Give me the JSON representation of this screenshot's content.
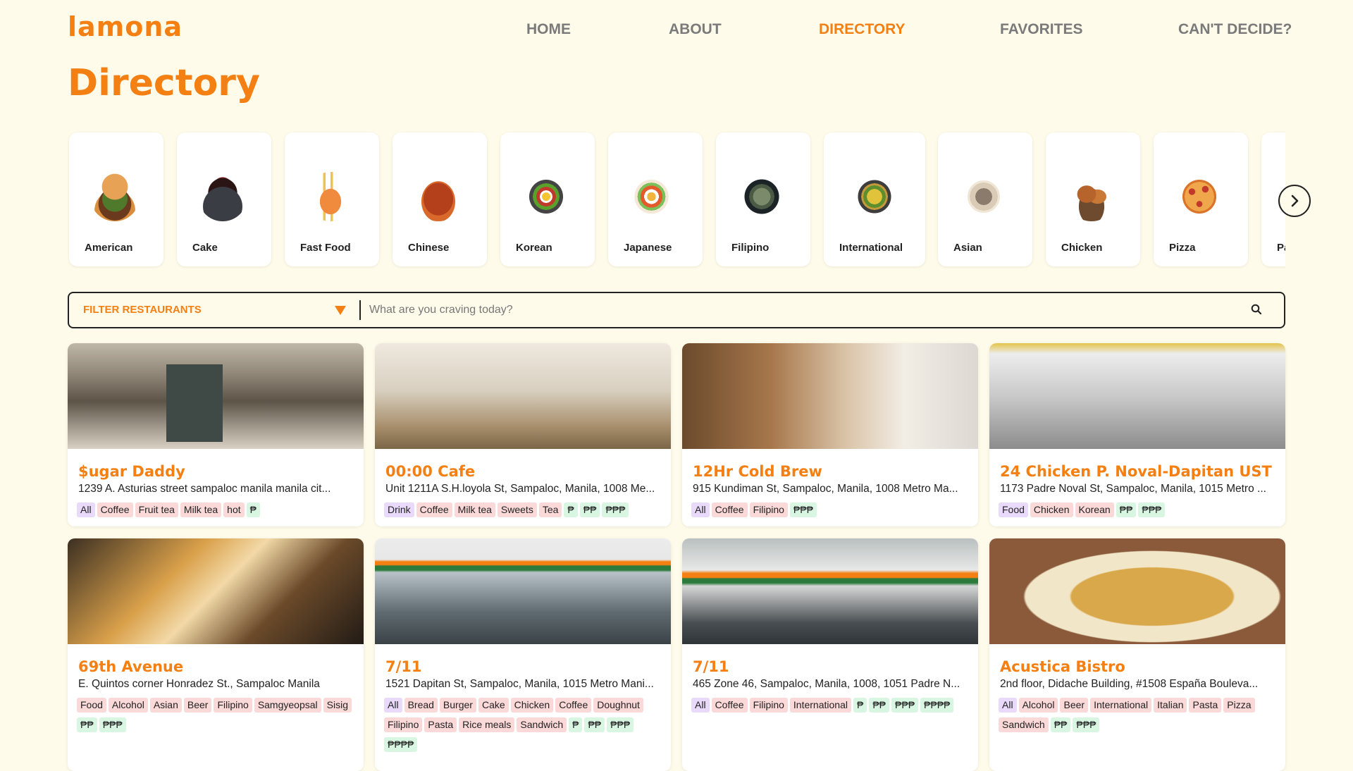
{
  "brand": {
    "logo": "lamona",
    "accent": "#f47f12"
  },
  "nav": [
    {
      "label": "HOME",
      "active": false
    },
    {
      "label": "ABOUT",
      "active": false
    },
    {
      "label": "DIRECTORY",
      "active": true
    },
    {
      "label": "FAVORITES",
      "active": false
    },
    {
      "label": "CAN'T DECIDE?",
      "active": false
    }
  ],
  "page": {
    "title": "Directory"
  },
  "categories": [
    {
      "label": "American",
      "icon": "burger"
    },
    {
      "label": "Cake",
      "icon": "cake"
    },
    {
      "label": "Fast Food",
      "icon": "fries"
    },
    {
      "label": "Chinese",
      "icon": "noodles"
    },
    {
      "label": "Korean",
      "icon": "bibimbap"
    },
    {
      "label": "Japanese",
      "icon": "ramen"
    },
    {
      "label": "Filipino",
      "icon": "filipino-dish"
    },
    {
      "label": "International",
      "icon": "salad"
    },
    {
      "label": "Asian",
      "icon": "rice-bowl"
    },
    {
      "label": "Chicken",
      "icon": "fried-chicken"
    },
    {
      "label": "Pizza",
      "icon": "pizza"
    },
    {
      "label": "Pa",
      "icon": "pasta"
    }
  ],
  "filter": {
    "label": "FILTER RESTAURANTS",
    "search_placeholder": "What are you craving today?"
  },
  "restaurants": [
    {
      "name": "$ugar Daddy",
      "address": "1239 A. Asturias street sampaloc manila manila cit...",
      "tags": [
        [
          "All",
          "all"
        ],
        [
          "Coffee",
          "cat"
        ],
        [
          "Fruit tea",
          "cat"
        ],
        [
          "Milk tea",
          "cat"
        ],
        [
          "hot",
          "cat"
        ],
        [
          "₱",
          "price"
        ]
      ]
    },
    {
      "name": "00:00 Cafe",
      "address": "Unit 1211A S.H.loyola St, Sampaloc, Manila, 1008 Me...",
      "tags": [
        [
          "Drink",
          "all"
        ],
        [
          "Coffee",
          "cat"
        ],
        [
          "Milk tea",
          "cat"
        ],
        [
          "Sweets",
          "cat"
        ],
        [
          "Tea",
          "cat"
        ],
        [
          "₱",
          "price"
        ],
        [
          "₱₱",
          "price"
        ],
        [
          "₱₱₱",
          "price"
        ]
      ]
    },
    {
      "name": "12Hr Cold Brew",
      "address": "915 Kundiman St, Sampaloc, Manila, 1008 Metro Ma...",
      "tags": [
        [
          "All",
          "all"
        ],
        [
          "Coffee",
          "cat"
        ],
        [
          "Filipino",
          "cat"
        ],
        [
          "₱₱₱",
          "price"
        ]
      ]
    },
    {
      "name": "24 Chicken P. Noval-Dapitan UST",
      "address": "1173 Padre Noval St, Sampaloc, Manila, 1015 Metro ...",
      "tags": [
        [
          "Food",
          "all"
        ],
        [
          "Chicken",
          "cat"
        ],
        [
          "Korean",
          "cat"
        ],
        [
          "₱₱",
          "price"
        ],
        [
          "₱₱₱",
          "price"
        ]
      ]
    },
    {
      "name": "69th Avenue",
      "address": "E. Quintos corner Honradez St., Sampaloc Manila",
      "tags": [
        [
          "Food",
          "cat"
        ],
        [
          "Alcohol",
          "cat"
        ],
        [
          "Asian",
          "cat"
        ],
        [
          "Beer",
          "cat"
        ],
        [
          "Filipino",
          "cat"
        ],
        [
          "Samgyeopsal",
          "cat"
        ],
        [
          "Sisig",
          "cat"
        ],
        [
          "₱₱",
          "price"
        ],
        [
          "₱₱₱",
          "price"
        ]
      ]
    },
    {
      "name": "7/11",
      "address": "1521 Dapitan St, Sampaloc, Manila, 1015 Metro Mani...",
      "tags": [
        [
          "All",
          "all"
        ],
        [
          "Bread",
          "cat"
        ],
        [
          "Burger",
          "cat"
        ],
        [
          "Cake",
          "cat"
        ],
        [
          "Chicken",
          "cat"
        ],
        [
          "Coffee",
          "cat"
        ],
        [
          "Doughnut",
          "cat"
        ],
        [
          "Filipino",
          "cat"
        ],
        [
          "Pasta",
          "cat"
        ],
        [
          "Rice meals",
          "cat"
        ],
        [
          "Sandwich",
          "cat"
        ],
        [
          "₱",
          "price"
        ],
        [
          "₱₱",
          "price"
        ],
        [
          "₱₱₱",
          "price"
        ],
        [
          "₱₱₱₱",
          "price"
        ]
      ]
    },
    {
      "name": "7/11",
      "address": "465 Zone 46, Sampaloc, Manila, 1008, 1051 Padre N...",
      "tags": [
        [
          "All",
          "all"
        ],
        [
          "Coffee",
          "cat"
        ],
        [
          "Filipino",
          "cat"
        ],
        [
          "International",
          "cat"
        ],
        [
          "₱",
          "price"
        ],
        [
          "₱₱",
          "price"
        ],
        [
          "₱₱₱",
          "price"
        ],
        [
          "₱₱₱₱",
          "price"
        ]
      ]
    },
    {
      "name": "Acustica Bistro",
      "address": "2nd floor, Didache Building, #1508 España Bouleva...",
      "tags": [
        [
          "All",
          "all"
        ],
        [
          "Alcohol",
          "cat"
        ],
        [
          "Beer",
          "cat"
        ],
        [
          "International",
          "cat"
        ],
        [
          "Italian",
          "cat"
        ],
        [
          "Pasta",
          "cat"
        ],
        [
          "Pizza",
          "cat"
        ],
        [
          "Sandwich",
          "cat"
        ],
        [
          "₱₱",
          "price"
        ],
        [
          "₱₱₱",
          "price"
        ]
      ]
    }
  ]
}
